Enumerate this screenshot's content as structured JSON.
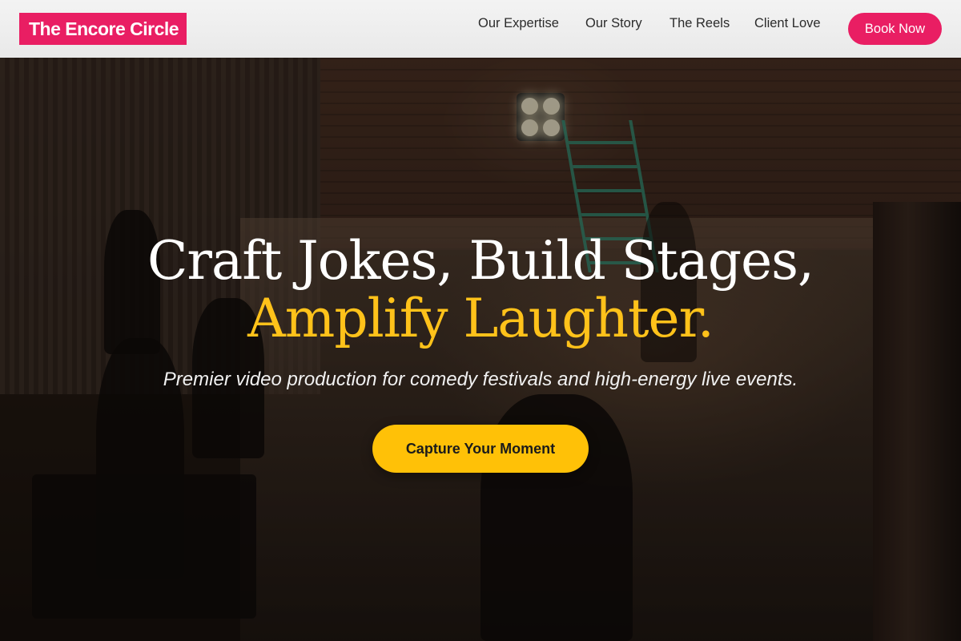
{
  "brand": {
    "name": "The Encore Circle",
    "accent_color": "#e91e63",
    "highlight_color": "#ffc107"
  },
  "nav": {
    "items": [
      {
        "label": "Our Expertise"
      },
      {
        "label": "Our Story"
      },
      {
        "label": "The Reels"
      },
      {
        "label": "Client Love"
      }
    ],
    "cta_label": "Book Now"
  },
  "hero": {
    "headline_line1": "Craft Jokes, Build Stages,",
    "headline_line2": "Amplify Laughter.",
    "subtitle": "Premier video production for comedy festivals and high-energy live events.",
    "cta_label": "Capture Your Moment"
  }
}
